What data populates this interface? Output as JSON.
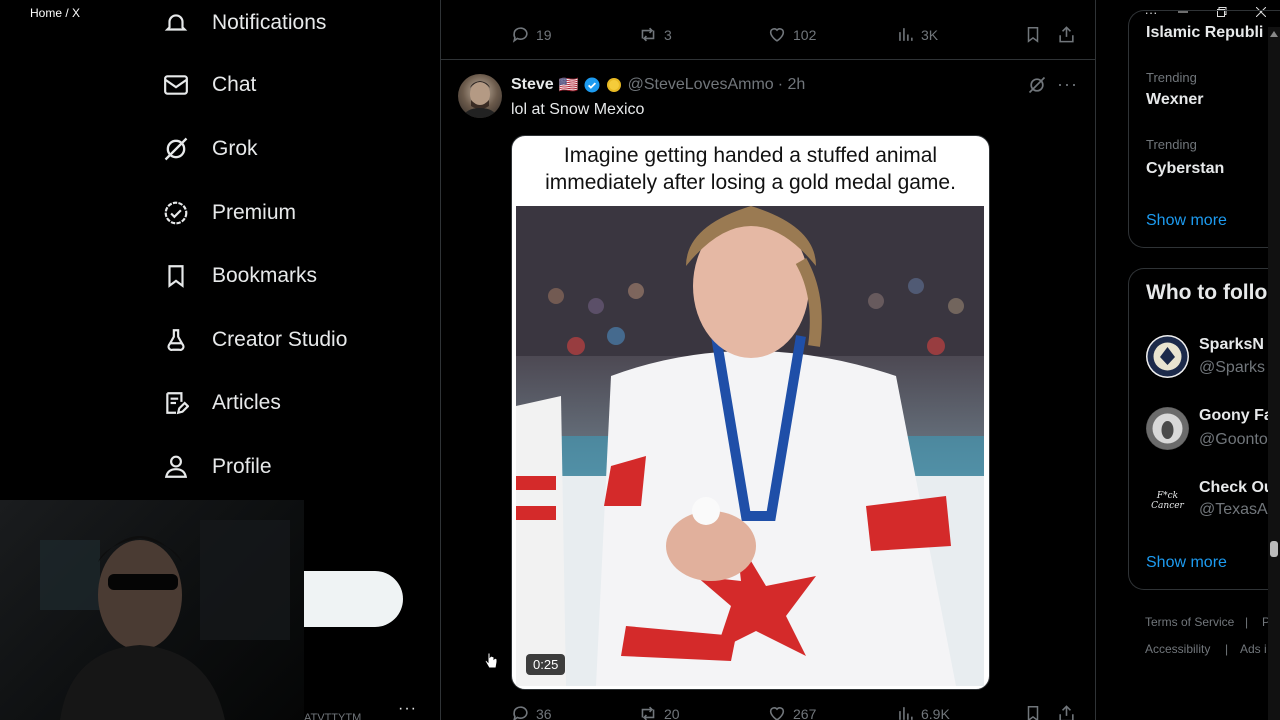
{
  "window": {
    "title": "Home / X"
  },
  "nav": {
    "items": [
      {
        "label": "Notifications",
        "icon": "bell-icon"
      },
      {
        "label": "Chat",
        "icon": "envelope-icon"
      },
      {
        "label": "Grok",
        "icon": "grok-icon"
      },
      {
        "label": "Premium",
        "icon": "verified-badge-icon"
      },
      {
        "label": "Bookmarks",
        "icon": "bookmark-icon"
      },
      {
        "label": "Creator Studio",
        "icon": "flask-icon"
      },
      {
        "label": "Articles",
        "icon": "article-icon"
      },
      {
        "label": "Profile",
        "icon": "person-icon"
      }
    ],
    "account_more": "···",
    "account_handle_fragment": "ATVTTYTM"
  },
  "previous_tweet": {
    "replies": "19",
    "reposts": "3",
    "likes": "102",
    "views": "3K"
  },
  "tweet": {
    "name": "Steve",
    "flag": "🇺🇸",
    "handle": "@SteveLovesAmmo",
    "time": "· 2h",
    "text": "lol at Snow Mexico",
    "media": {
      "caption_line1": "Imagine getting handed a stuffed animal",
      "caption_line2": "immediately after losing a gold medal game.",
      "duration": "0:25"
    },
    "replies": "36",
    "reposts": "20",
    "likes": "267",
    "views": "6.9K"
  },
  "trends": {
    "top_fragment": "Islamic Republi",
    "items": [
      {
        "context": "Trending",
        "name": "Wexner"
      },
      {
        "context": "Trending",
        "name": "Cyberstan"
      }
    ],
    "show_more": "Show more"
  },
  "who_to_follow": {
    "title": "Who to follo",
    "accounts": [
      {
        "name": "SparksN",
        "handle": "@Sparks"
      },
      {
        "name": "Goony Fa",
        "handle": "@Goonto"
      },
      {
        "name": "Check Ou",
        "handle": "@TexasA",
        "avatar_text": "F*ck Cancer"
      }
    ],
    "show_more": "Show more"
  },
  "footer": {
    "links": [
      "Terms of Service",
      "|",
      "P",
      "Accessibility",
      "|",
      "Ads i"
    ]
  },
  "colors": {
    "accent": "#1d9bf0",
    "background": "#000000",
    "muted": "#71767b",
    "border": "#2f3336"
  }
}
